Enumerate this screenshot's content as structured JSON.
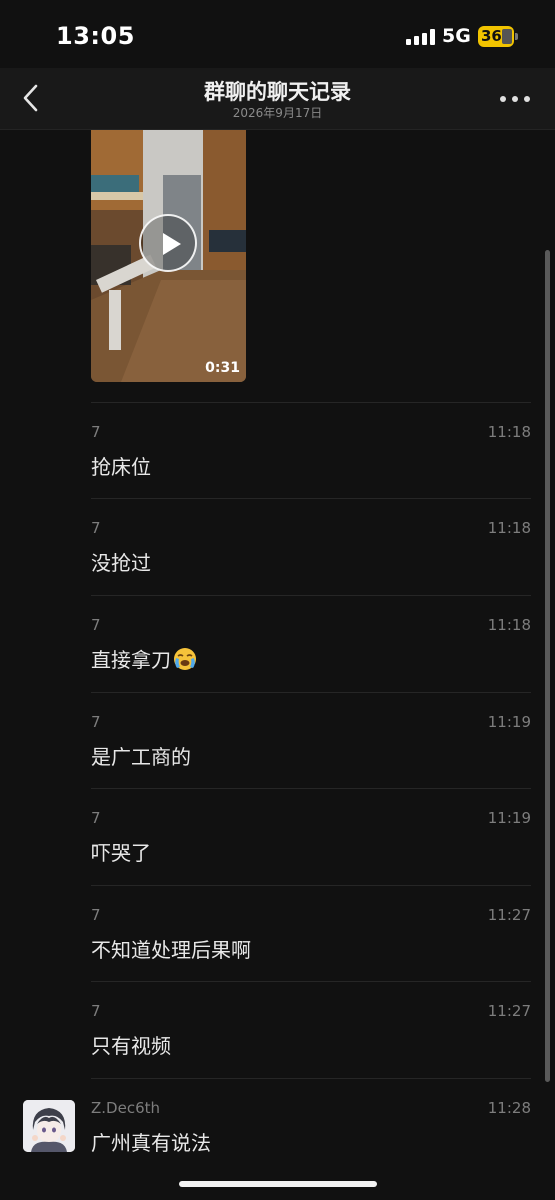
{
  "status_bar": {
    "time": "13:05",
    "network": "5G",
    "battery": "36"
  },
  "header": {
    "title": "群聊的聊天记录",
    "subtitle": "2026年9月17日"
  },
  "video": {
    "duration": "0:31"
  },
  "messages": [
    {
      "sender": "7",
      "time": "11:18",
      "text": "抢床位"
    },
    {
      "sender": "7",
      "time": "11:18",
      "text": "没抢过"
    },
    {
      "sender": "7",
      "time": "11:18",
      "text": "直接拿刀",
      "emoji": "loudly-crying-face"
    },
    {
      "sender": "7",
      "time": "11:19",
      "text": "是广工商的"
    },
    {
      "sender": "7",
      "time": "11:19",
      "text": "吓哭了"
    },
    {
      "sender": "7",
      "time": "11:27",
      "text": "不知道处理后果啊"
    },
    {
      "sender": "7",
      "time": "11:27",
      "text": "只有视频"
    },
    {
      "sender": "Z.Dec6th",
      "time": "11:28",
      "text": "广州真有说法"
    }
  ],
  "icons": {
    "back": "chevron-left-icon",
    "more": "more-dots-icon",
    "play": "play-icon",
    "signal": "signal-icon",
    "battery": "battery-charging-icon"
  },
  "colors": {
    "background": "#111111",
    "nav_background": "#191919",
    "battery": "#f2c400",
    "secondary_text": "#7d7d7d"
  }
}
